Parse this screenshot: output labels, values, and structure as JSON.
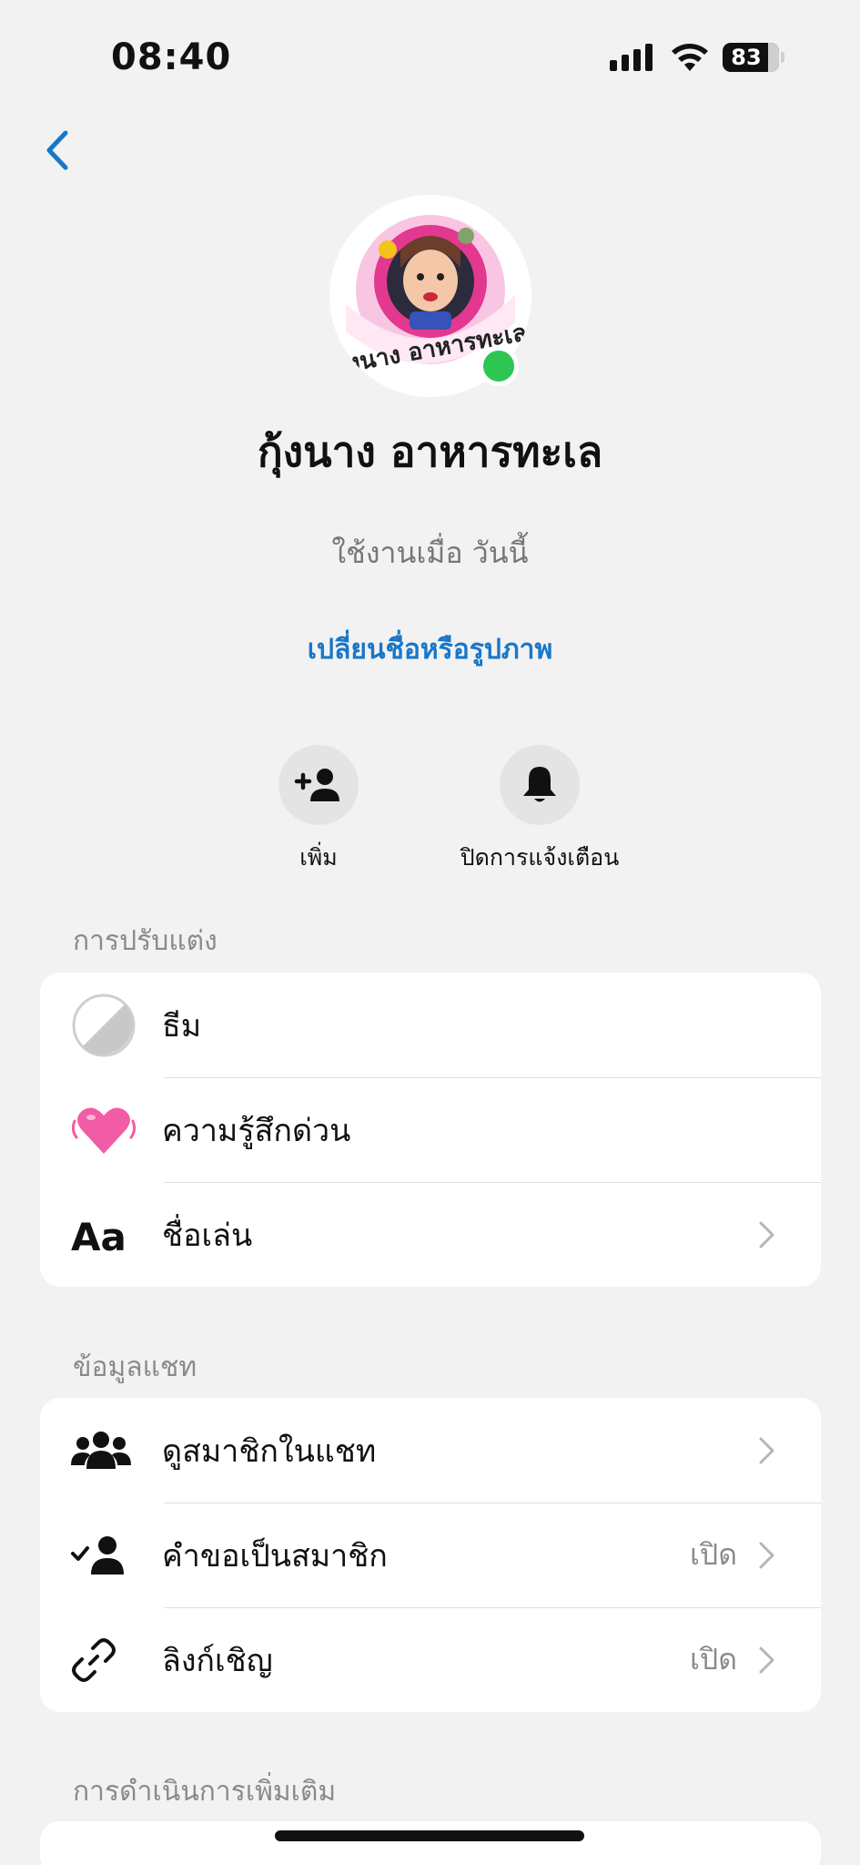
{
  "status": {
    "time": "08:40",
    "battery": "83"
  },
  "profile": {
    "name": "กุ้งนาง อาหารทะเล",
    "active_status": "ใช้งานเมื่อ วันนี้",
    "change_link": "เปลี่ยนชื่อหรือรูปภาพ",
    "avatar_text": "กุ้งนาง อาหารทะเล"
  },
  "actions": [
    {
      "label": "เพิ่ม",
      "icon": "add-person-icon"
    },
    {
      "label": "ปิดการแจ้งเตือน",
      "icon": "bell-icon"
    }
  ],
  "sections": {
    "customize": {
      "title": "การปรับแต่ง",
      "items": [
        {
          "label": "ธีม",
          "icon": "theme-icon"
        },
        {
          "label": "ความรู้สึกด่วน",
          "icon": "heart-emoji-icon"
        },
        {
          "label": "ชื่อเล่น",
          "icon": "text-aa-icon"
        }
      ]
    },
    "chat_info": {
      "title": "ข้อมูลแชท",
      "items": [
        {
          "label": "ดูสมาชิกในแชท",
          "icon": "people-icon",
          "value": ""
        },
        {
          "label": "คำขอเป็นสมาชิก",
          "icon": "person-check-icon",
          "value": "เปิด"
        },
        {
          "label": "ลิงก์เชิญ",
          "icon": "link-icon",
          "value": "เปิด"
        }
      ]
    },
    "more_actions": {
      "title": "การดำเนินการเพิ่มเติม"
    }
  },
  "colors": {
    "accent": "#1877c9",
    "online": "#2dc653",
    "background": "#f2f2f2"
  }
}
